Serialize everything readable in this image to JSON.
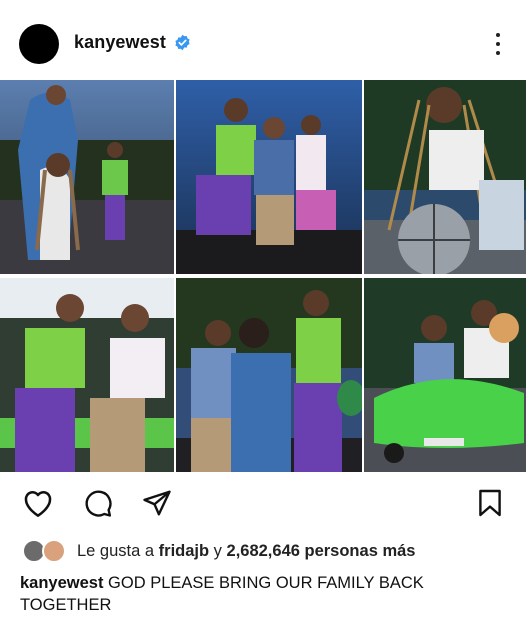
{
  "post": {
    "username": "kanyewest",
    "verified": true,
    "icons": [
      "verified-badge-icon",
      "more-options-icon",
      "heart-icon",
      "comment-icon",
      "share-icon",
      "bookmark-icon"
    ],
    "accent_color": "#3897f0",
    "likes": {
      "prefix": "Le gusta a",
      "first_liker": "fridajb",
      "conjunction": "y",
      "count_text": "2,682,646 personas más"
    },
    "caption": {
      "username": "kanyewest",
      "text": "GOD PLEASE BRING OUR FAMILY BACK TOGETHER"
    },
    "photos": [
      {
        "id": "photo-1"
      },
      {
        "id": "photo-2"
      },
      {
        "id": "photo-3"
      },
      {
        "id": "photo-4"
      },
      {
        "id": "photo-5"
      },
      {
        "id": "photo-6"
      }
    ]
  }
}
